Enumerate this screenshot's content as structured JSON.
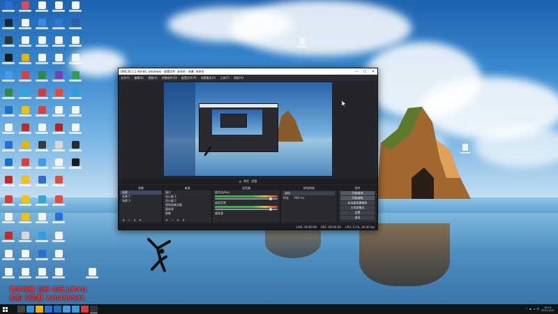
{
  "obs": {
    "title": "OBS 26.1.1 (64-bit, windows) - 配置文件: 未命名 - 场景: 未命名",
    "menu": [
      "文件(F)",
      "编辑(E)",
      "视图(V)",
      "停靠部件(D)",
      "配置文件(P)",
      "场景集合(S)",
      "工具(T)",
      "帮助(H)"
    ],
    "window_buttons": [
      "—",
      "☐",
      "✕"
    ],
    "mid_bar": [
      "⚙",
      "属性",
      "滤镜"
    ],
    "docks": {
      "scenes": {
        "title": "场景",
        "items": [
          "场景",
          "场景 2",
          "场景 3"
        ]
      },
      "sources": {
        "title": "来源",
        "items": [
          "窗口",
          "显示器 1",
          "显示器 2",
          "视频采集设备",
          "媒体源",
          "图像"
        ]
      },
      "mixer": {
        "title": "混音器",
        "channels": [
          "麦克风/Aux",
          "桌面音频",
          "媒体源"
        ]
      },
      "transitions": {
        "title": "转场特效",
        "type": "淡出",
        "duration_label": "时长",
        "duration": "300 ms"
      },
      "controls": {
        "title": "控件",
        "buttons": [
          "开始推流",
          "开始录制",
          "启动虚拟摄像机",
          "工作室模式",
          "设置",
          "退出"
        ]
      }
    },
    "tools": [
      "+",
      "−",
      "∧",
      "∨"
    ],
    "status": [
      "LIVE: 00:00:00",
      "REC: 00:00:00",
      "CPU: 2.1%, 30.00 fps"
    ]
  },
  "overlay": {
    "line1": "教学视频 日线 年近上单YD",
    "line2": "扣扣 交流群 230459531"
  },
  "taskbar": {
    "time": "10:14",
    "date": "2021/1/20",
    "lang": "中"
  },
  "colors": {
    "obs_bg": "#24252b",
    "overlay_text": "#ff3a3a",
    "taskbar": "#111418"
  }
}
